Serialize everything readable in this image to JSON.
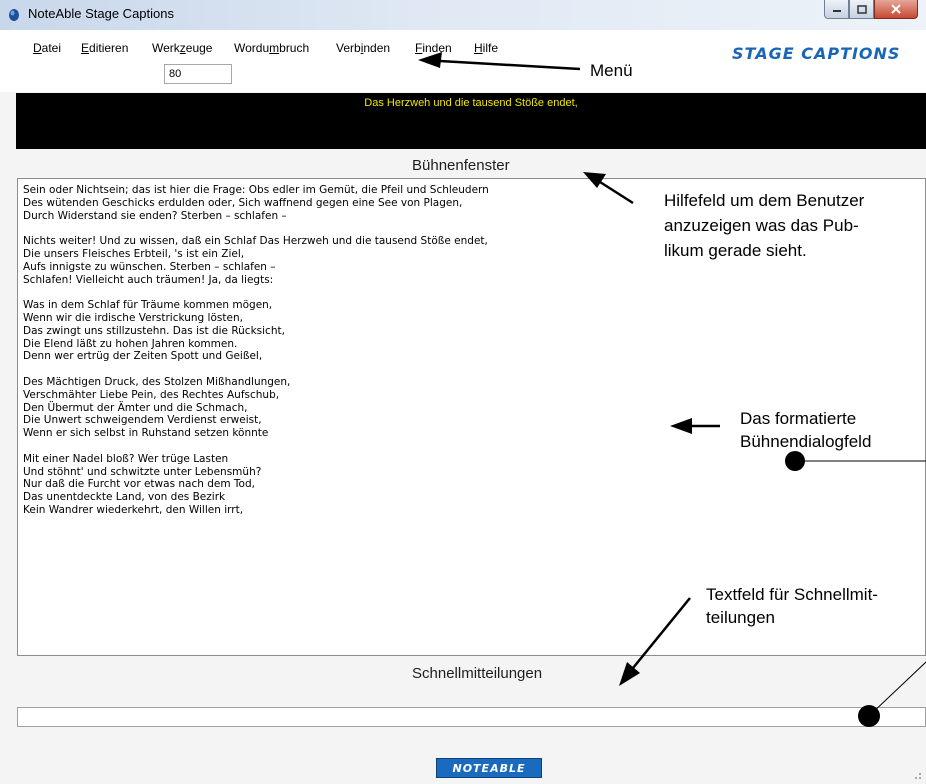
{
  "window": {
    "title": "NoteAble Stage Captions"
  },
  "menu": {
    "items": [
      {
        "pre": "",
        "u": "D",
        "post": "atei"
      },
      {
        "pre": "",
        "u": "E",
        "post": "ditieren"
      },
      {
        "pre": "Werk",
        "u": "z",
        "post": "euge"
      },
      {
        "pre": "Wordu",
        "u": "m",
        "post": "bruch"
      },
      {
        "pre": "Verb",
        "u": "i",
        "post": "nden"
      },
      {
        "pre": "",
        "u": "F",
        "post": "inden"
      },
      {
        "pre": "",
        "u": "H",
        "post": "ilfe"
      }
    ]
  },
  "zoom": {
    "value": "80"
  },
  "brand": "STAGE CAPTIONS",
  "stage": {
    "caption": "Das Herzweh und die tausend Stöße endet,"
  },
  "labels": {
    "stage_window": "Bühnenfenster",
    "quick_messages": "Schnellmitteilungen"
  },
  "dialog": {
    "text": "Sein oder Nichtsein; das ist hier die Frage: Obs edler im Gemüt, die Pfeil und Schleudern\nDes wütenden Geschicks erdulden oder, Sich waffnend gegen eine See von Plagen,\nDurch Widerstand sie enden? Sterben – schlafen –\n\nNichts weiter! Und zu wissen, daß ein Schlaf Das Herzweh und die tausend Stöße endet,\nDie unsers Fleisches Erbteil, 's ist ein Ziel,\nAufs innigste zu wünschen. Sterben – schlafen –\nSchlafen! Vielleicht auch träumen! Ja, da liegts:\n\nWas in dem Schlaf für Träume kommen mögen,\nWenn wir die irdische Verstrickung lösten,\nDas zwingt uns stillzustehn. Das ist die Rücksicht,\nDie Elend läßt zu hohen Jahren kommen.\nDenn wer ertrüg der Zeiten Spott und Geißel,\n\nDes Mächtigen Druck, des Stolzen Mißhandlungen,\nVerschmähter Liebe Pein, des Rechtes Aufschub,\nDen Übermut der Ämter und die Schmach,\nDie Unwert schweigendem Verdienst erweist,\nWenn er sich selbst in Ruhstand setzen könnte\n\nMit einer Nadel bloß? Wer trüge Lasten\nUnd stöhnt' und schwitzte unter Lebensmüh?\nNur daß die Furcht vor etwas nach dem Tod,\nDas unentdeckte Land, von des Bezirk\nKein Wandrer wiederkehrt, den Willen irrt,"
  },
  "quick_input": {
    "value": ""
  },
  "footer_logo": "NOTEABLE",
  "annotations": {
    "menu": "Menü",
    "help_l1": "Hilfefeld um dem Benutzer",
    "help_l2": "anzuzeigen was das Pub-",
    "help_l3": "likum gerade sieht.",
    "dialog_l1": "Das formatierte",
    "dialog_l2": "Bühnendialogfeld",
    "quick_l1": "Textfeld für Schnellmit-",
    "quick_l2": "teilungen"
  },
  "colors": {
    "stage_bg": "#000000",
    "caption": "#f2e600",
    "brand": "#1a66b6",
    "logo_bg": "#1a6abf"
  },
  "icons": [
    "app-icon",
    "minimize-icon",
    "maximize-icon",
    "close-icon",
    "resize-grip-icon"
  ]
}
